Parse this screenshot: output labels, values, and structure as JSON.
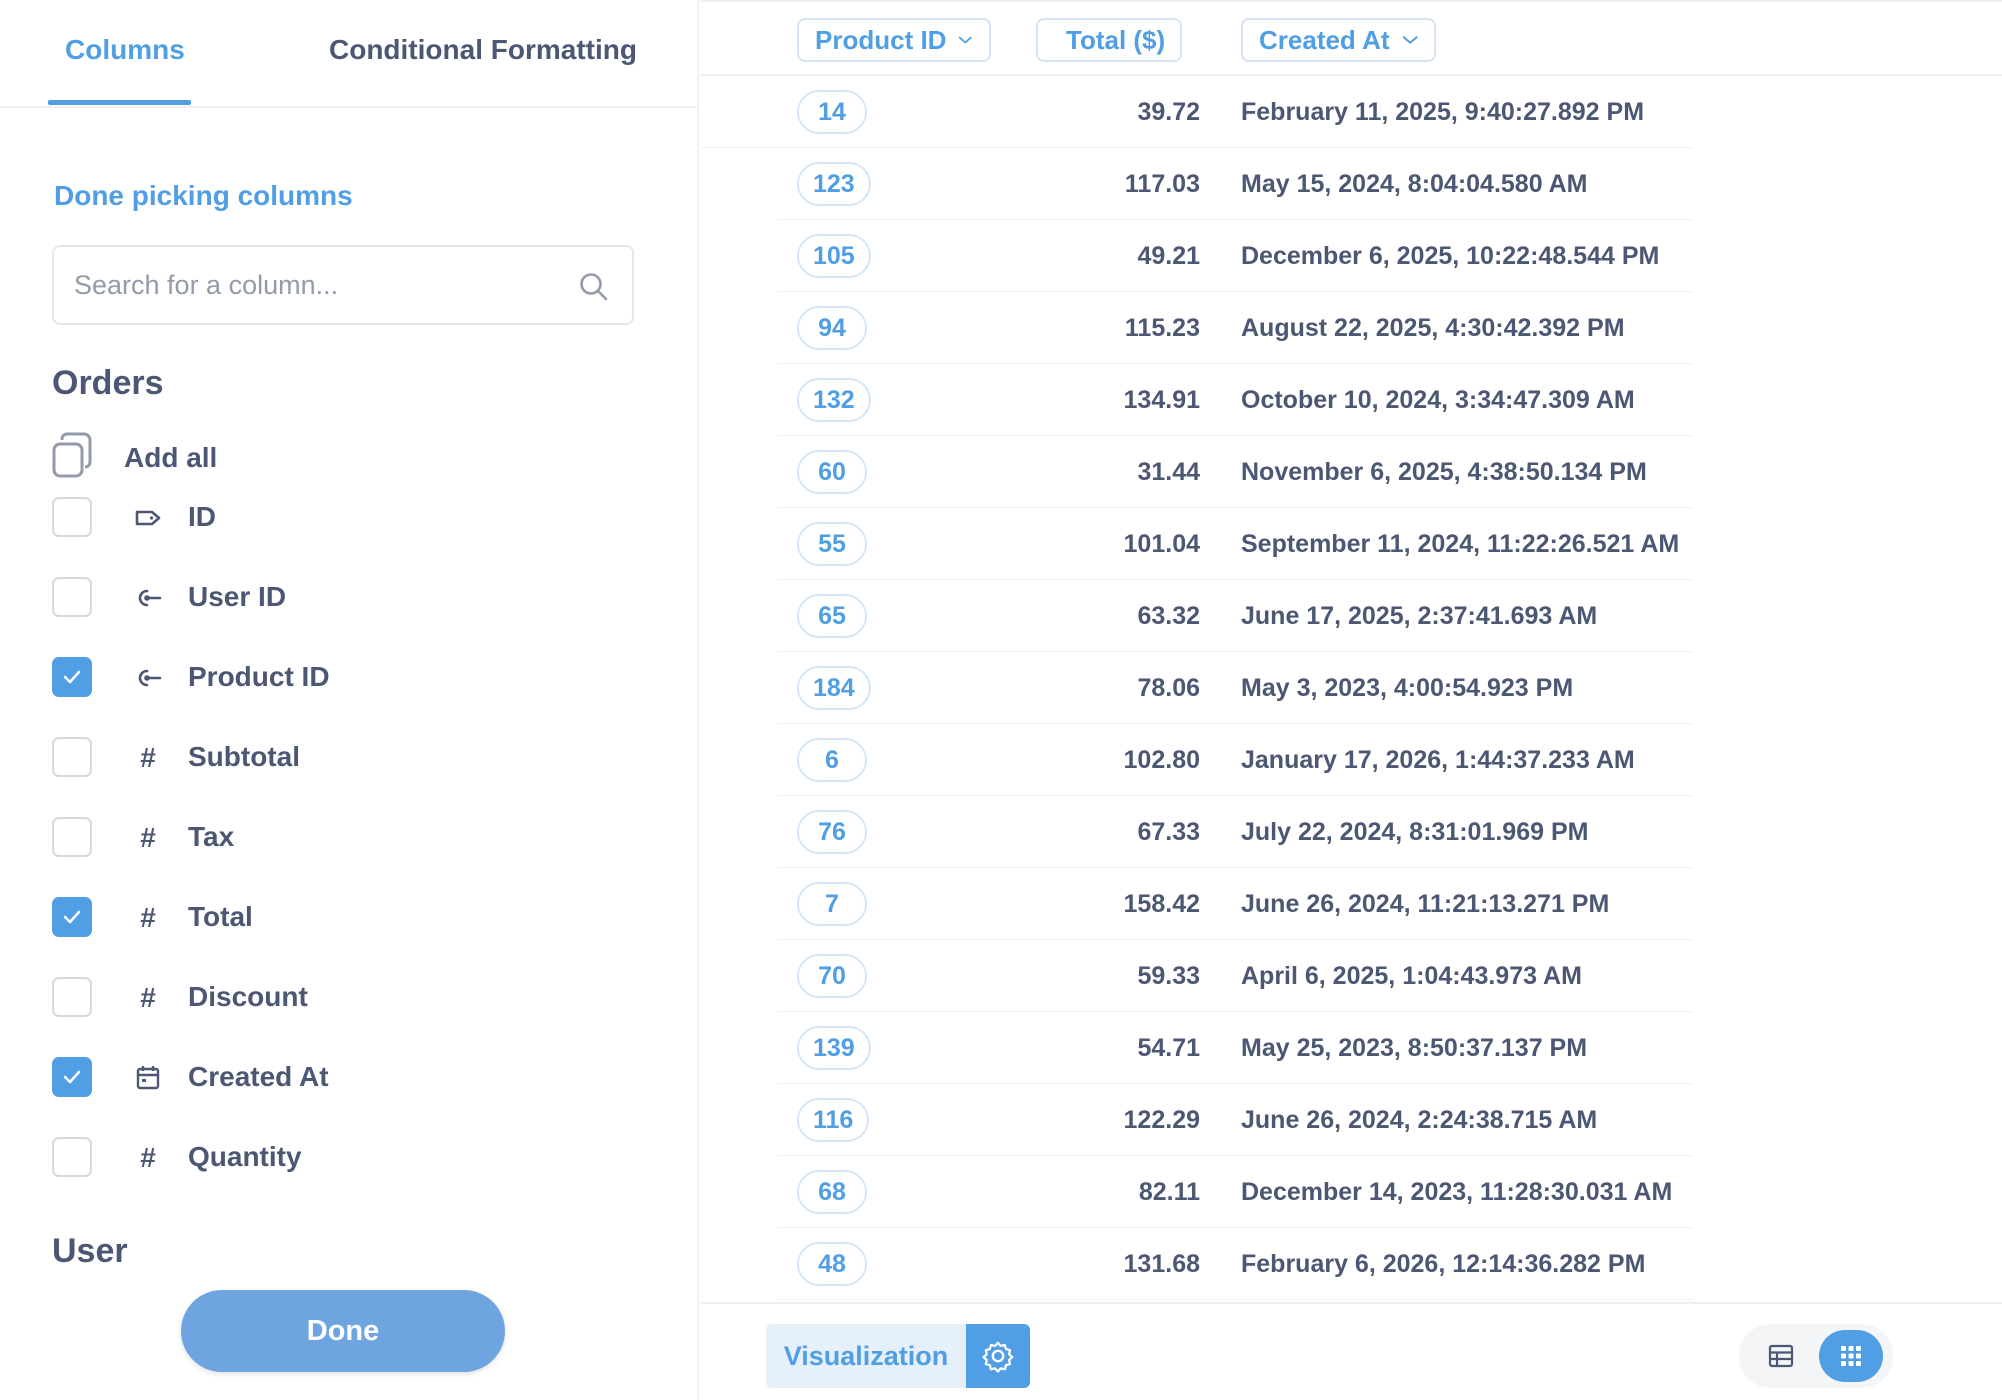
{
  "tabs": {
    "columns": "Columns",
    "conditional_formatting": "Conditional Formatting"
  },
  "picker": {
    "done_picking": "Done picking columns",
    "search_placeholder": "Search for a column...",
    "section_orders": "Orders",
    "add_all": "Add all",
    "section_user": "User",
    "columns": [
      {
        "label": "ID",
        "icon": "tag-icon",
        "checked": false
      },
      {
        "label": "User ID",
        "icon": "foreign-key-icon",
        "checked": false
      },
      {
        "label": "Product ID",
        "icon": "foreign-key-icon",
        "checked": true
      },
      {
        "label": "Subtotal",
        "icon": "number-icon",
        "checked": false
      },
      {
        "label": "Tax",
        "icon": "number-icon",
        "checked": false
      },
      {
        "label": "Total",
        "icon": "number-icon",
        "checked": true
      },
      {
        "label": "Discount",
        "icon": "number-icon",
        "checked": false
      },
      {
        "label": "Created At",
        "icon": "calendar-icon",
        "checked": true
      },
      {
        "label": "Quantity",
        "icon": "number-icon",
        "checked": false
      }
    ],
    "done_button": "Done"
  },
  "table": {
    "headers": {
      "product_id": "Product ID",
      "total": "Total ($)",
      "created_at": "Created At"
    },
    "rows": [
      {
        "product_id": "14",
        "total": "39.72",
        "created_at": "February 11, 2025, 9:40:27.892 PM"
      },
      {
        "product_id": "123",
        "total": "117.03",
        "created_at": "May 15, 2024, 8:04:04.580 AM"
      },
      {
        "product_id": "105",
        "total": "49.21",
        "created_at": "December 6, 2025, 10:22:48.544 PM"
      },
      {
        "product_id": "94",
        "total": "115.23",
        "created_at": "August 22, 2025, 4:30:42.392 PM"
      },
      {
        "product_id": "132",
        "total": "134.91",
        "created_at": "October 10, 2024, 3:34:47.309 AM"
      },
      {
        "product_id": "60",
        "total": "31.44",
        "created_at": "November 6, 2025, 4:38:50.134 PM"
      },
      {
        "product_id": "55",
        "total": "101.04",
        "created_at": "September 11, 2024, 11:22:26.521 AM"
      },
      {
        "product_id": "65",
        "total": "63.32",
        "created_at": "June 17, 2025, 2:37:41.693 AM"
      },
      {
        "product_id": "184",
        "total": "78.06",
        "created_at": "May 3, 2023, 4:00:54.923 PM"
      },
      {
        "product_id": "6",
        "total": "102.80",
        "created_at": "January 17, 2026, 1:44:37.233 AM"
      },
      {
        "product_id": "76",
        "total": "67.33",
        "created_at": "July 22, 2024, 8:31:01.969 PM"
      },
      {
        "product_id": "7",
        "total": "158.42",
        "created_at": "June 26, 2024, 11:21:13.271 PM"
      },
      {
        "product_id": "70",
        "total": "59.33",
        "created_at": "April 6, 2025, 1:04:43.973 AM"
      },
      {
        "product_id": "139",
        "total": "54.71",
        "created_at": "May 25, 2023, 8:50:37.137 PM"
      },
      {
        "product_id": "116",
        "total": "122.29",
        "created_at": "June 26, 2024, 2:24:38.715 AM"
      },
      {
        "product_id": "68",
        "total": "82.11",
        "created_at": "December 14, 2023, 11:28:30.031 AM"
      },
      {
        "product_id": "48",
        "total": "131.68",
        "created_at": "February 6, 2026, 12:14:36.282 PM"
      }
    ]
  },
  "footer": {
    "visualization": "Visualization",
    "settings_icon": "gear-icon",
    "table_view_icon": "table-icon",
    "grid_view_icon": "grid-icon"
  },
  "colors": {
    "brand": "#509ee3",
    "text": "#4c5773",
    "border": "#eef0f3"
  }
}
